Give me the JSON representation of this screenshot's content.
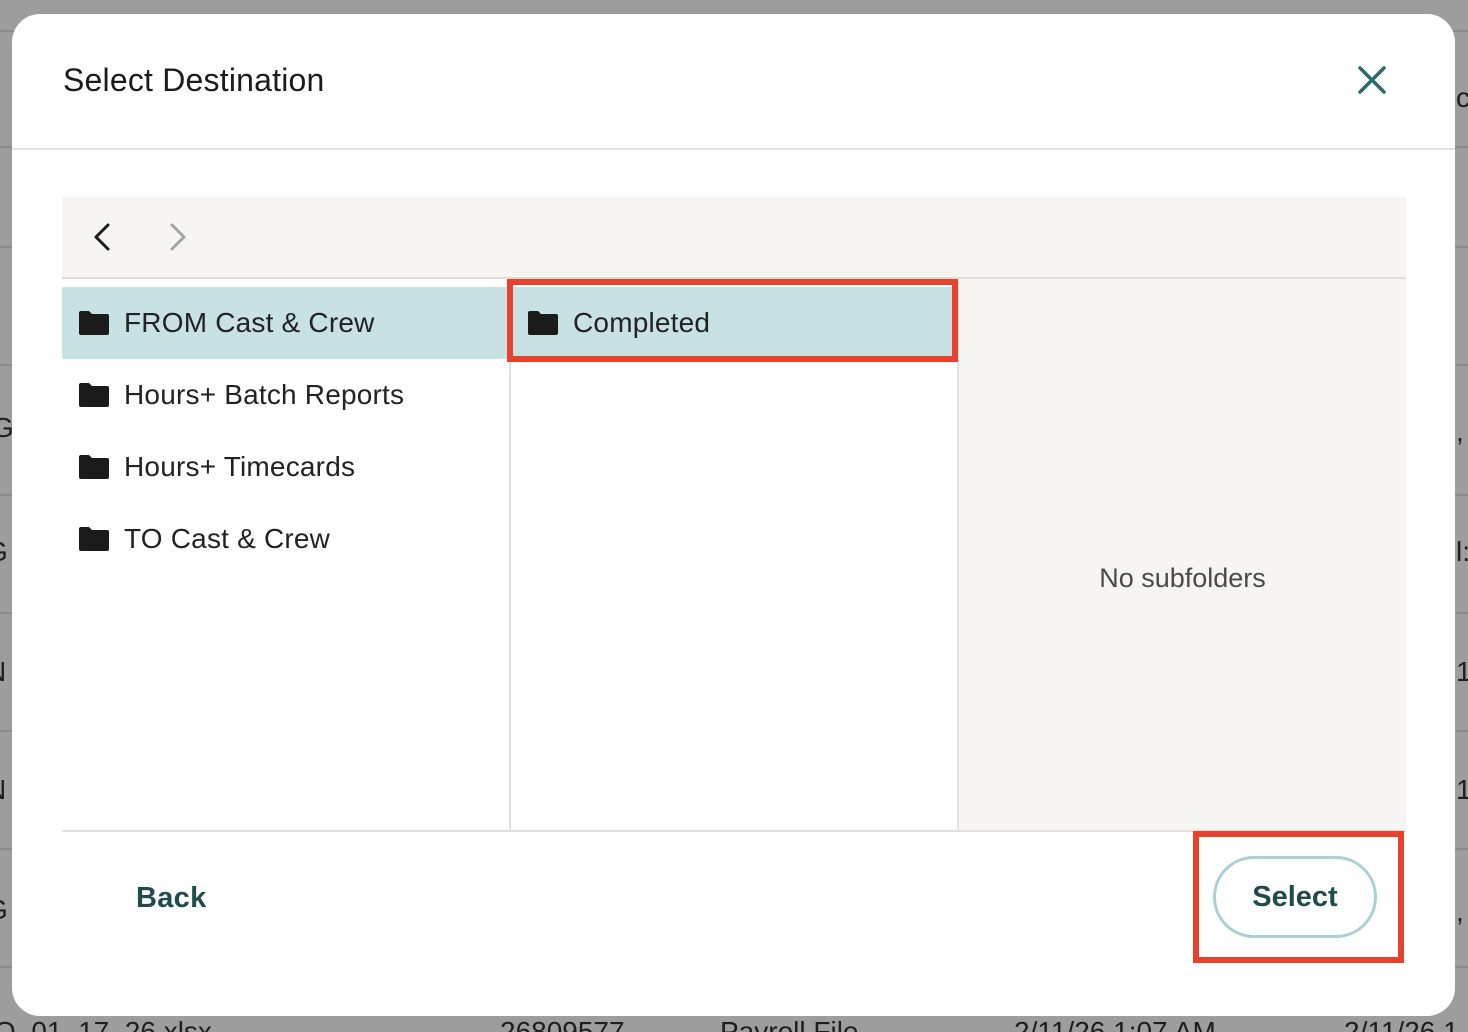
{
  "background": {
    "left_fragments": [
      "G.",
      "G",
      "N",
      "N",
      "G"
    ],
    "right_fragments": [
      "c",
      ",",
      "l:",
      "1",
      "1",
      ","
    ],
    "bottom_row": [
      "O_01_17_26.xlsx",
      "26809577",
      "Payroll File",
      "2/11/26 1:07 AM",
      "2/11/26 1"
    ]
  },
  "modal": {
    "title": "Select Destination"
  },
  "browser": {
    "columns": [
      {
        "items": [
          {
            "label": "FROM Cast & Crew",
            "selected": true
          },
          {
            "label": "Hours+ Batch Reports",
            "selected": false
          },
          {
            "label": "Hours+ Timecards",
            "selected": false
          },
          {
            "label": "TO Cast & Crew",
            "selected": false
          }
        ]
      },
      {
        "items": [
          {
            "label": "Completed",
            "selected": true
          }
        ]
      }
    ],
    "empty_message": "No subfolders"
  },
  "footer": {
    "back_label": "Back",
    "select_label": "Select"
  },
  "colors": {
    "selected_bg": "#c8e1e3",
    "accent": "#1f4b4d",
    "highlight": "#e8412c",
    "panel_bg": "#f7f5f1"
  },
  "icons": [
    "close-icon",
    "chevron-left-icon",
    "chevron-right-icon",
    "folder-icon"
  ]
}
